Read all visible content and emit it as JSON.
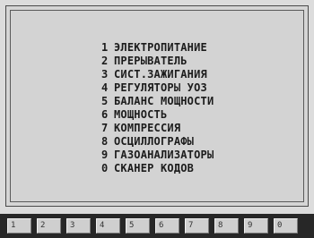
{
  "menu": {
    "items": [
      {
        "num": "1",
        "label": "ЭЛЕКТРОПИТАНИЕ"
      },
      {
        "num": "2",
        "label": "ПРЕРЫВАТЕЛЬ"
      },
      {
        "num": "3",
        "label": "СИСТ.ЗАЖИГАНИЯ"
      },
      {
        "num": "4",
        "label": "РЕГУЛЯТОРЫ УОЗ"
      },
      {
        "num": "5",
        "label": "БАЛАНС МОЩНОСТИ"
      },
      {
        "num": "6",
        "label": "МОЩНОСТЬ"
      },
      {
        "num": "7",
        "label": "КОМПРЕССИЯ"
      },
      {
        "num": "8",
        "label": "ОСЦИЛЛОГРАФЫ"
      },
      {
        "num": "9",
        "label": "ГАЗОАНАЛИЗАТОРЫ"
      },
      {
        "num": "0",
        "label": "СКАНЕР КОДОВ"
      }
    ]
  },
  "function_keys": [
    "1",
    "2",
    "3",
    "4",
    "5",
    "6",
    "7",
    "8",
    "9",
    "0"
  ]
}
